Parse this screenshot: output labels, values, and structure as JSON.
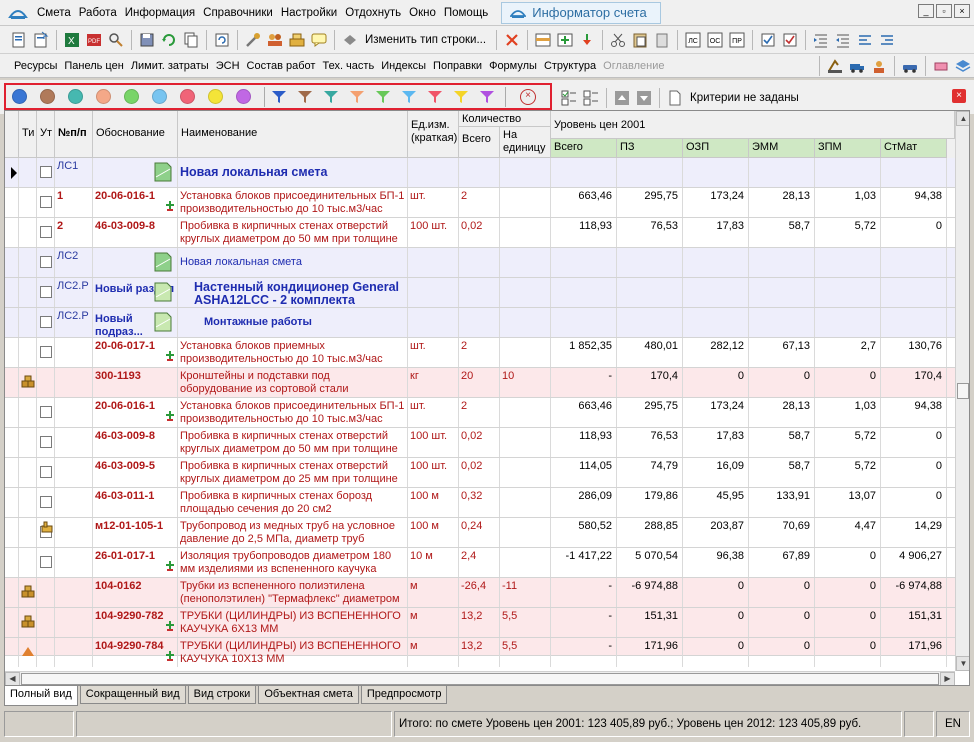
{
  "menu": {
    "items": [
      "Смета",
      "Работа",
      "Информация",
      "Справочники",
      "Настройки",
      "Отдохнуть",
      "Окно",
      "Помощь"
    ],
    "informer_tab": "Информатор счета",
    "win_buttons": [
      "_",
      "▫",
      "×"
    ]
  },
  "toolbar": {
    "change_row_type": "Изменить тип строки...",
    "icon_labels": [
      "ЛС",
      "ОС",
      "ПР"
    ]
  },
  "toolbar2": {
    "items": [
      "Ресурсы",
      "Панель цен",
      "Лимит. затраты",
      "ЭСН",
      "Состав работ",
      "Тех. часть",
      "Индексы",
      "Поправки",
      "Формулы",
      "Структура"
    ],
    "disabled_item": "Оглавление"
  },
  "filter": {
    "dot_colors": [
      "#3a76d4",
      "#b07a5a",
      "#46b8b0",
      "#f4a888",
      "#78d468",
      "#78c4f0",
      "#f06478",
      "#f4e438",
      "#c068e4"
    ],
    "funnel_colors": [
      "#2b5cc8",
      "#a06a4a",
      "#38a8a0",
      "#f4a070",
      "#68c858",
      "#5cb8f0",
      "#f05468",
      "#f4d428",
      "#b050e0"
    ],
    "criteria_text": "Критерии не заданы"
  },
  "grid": {
    "headers": {
      "ti": "Ти",
      "ut": "Ут",
      "npp": "№п/п",
      "obosn": "Обоснование",
      "naim": "Наименование",
      "edizm": "Ед.изм. (краткая)",
      "kolvo": "Количество",
      "vsego_q": "Всего",
      "na_ed": "На единицу",
      "level": "Уровень цен 2001",
      "vsego": "Всего",
      "pz": "ПЗ",
      "ozp": "ОЗП",
      "emm": "ЭММ",
      "zpm": "ЗПМ",
      "stmat": "СтМат"
    },
    "rows": [
      {
        "type": "section",
        "npp": "ЛС1",
        "title": "Новая локальная смета",
        "title_style": "bold",
        "icon": "ЛС"
      },
      {
        "type": "work",
        "npp": "1",
        "code": "20-06-016-1",
        "name": "Установка блоков присоединительных БП-1 производительностью до 10 тыс.м3/час",
        "unit": "шт.",
        "qty": "2",
        "per": "",
        "total": "663,46",
        "pz": "295,75",
        "ozp": "173,24",
        "emm": "28,13",
        "zpm": "1,03",
        "stmat": "94,38",
        "plus": true
      },
      {
        "type": "work",
        "npp": "2",
        "code": "46-03-009-8",
        "name": "Пробивка в кирпичных стенах отверстий круглых диаметром до 50 мм при толщине",
        "unit": "100 шт.",
        "qty": "0,02",
        "per": "",
        "total": "118,93",
        "pz": "76,53",
        "ozp": "17,83",
        "emm": "58,7",
        "zpm": "5,72",
        "stmat": "0",
        "plus": false
      },
      {
        "type": "section",
        "npp": "ЛС2",
        "title": "Новая локальная смета",
        "title_style": "normal",
        "icon": "ЛС"
      },
      {
        "type": "section",
        "npp": "ЛС2.Р",
        "code_label": "Новый раздел",
        "title": "Настенный кондиционер General ASHA12LCC - 2 комплекта",
        "title_style": "bold",
        "icon": "Р"
      },
      {
        "type": "section",
        "npp": "ЛС2.Р",
        "code_label": "Новый подраз...",
        "title": "Монтажные работы",
        "title_style": "sub",
        "icon": "ПР"
      },
      {
        "type": "work",
        "npp": "",
        "code": "20-06-017-1",
        "name": "Установка блоков приемных производительностью до 10 тыс.м3/час",
        "unit": "шт.",
        "qty": "2",
        "per": "",
        "total": "1 852,35",
        "pz": "480,01",
        "ozp": "282,12",
        "emm": "67,13",
        "zpm": "2,7",
        "stmat": "130,76",
        "plus": true
      },
      {
        "type": "material",
        "npp": "",
        "code": "300-1193",
        "name": "Кронштейны и подставки под оборудование из сортовой стали",
        "unit": "кг",
        "qty": "20",
        "per": "10",
        "total": "-",
        "pz": "170,4",
        "ozp": "0",
        "emm": "0",
        "zpm": "0",
        "stmat": "170,4",
        "plus": false
      },
      {
        "type": "work",
        "npp": "",
        "code": "20-06-016-1",
        "name": "Установка блоков присоединительных БП-1 производительностью до 10 тыс.м3/час",
        "unit": "шт.",
        "qty": "2",
        "per": "",
        "total": "663,46",
        "pz": "295,75",
        "ozp": "173,24",
        "emm": "28,13",
        "zpm": "1,03",
        "stmat": "94,38",
        "plus": true
      },
      {
        "type": "work",
        "npp": "",
        "code": "46-03-009-8",
        "name": "Пробивка в кирпичных стенах отверстий круглых диаметром до 50 мм при толщине",
        "unit": "100 шт.",
        "qty": "0,02",
        "per": "",
        "total": "118,93",
        "pz": "76,53",
        "ozp": "17,83",
        "emm": "58,7",
        "zpm": "5,72",
        "stmat": "0",
        "plus": false
      },
      {
        "type": "work",
        "npp": "",
        "code": "46-03-009-5",
        "name": "Пробивка в кирпичных стенах отверстий круглых диаметром до 25 мм при толщине",
        "unit": "100 шт.",
        "qty": "0,02",
        "per": "",
        "total": "114,05",
        "pz": "74,79",
        "ozp": "16,09",
        "emm": "58,7",
        "zpm": "5,72",
        "stmat": "0",
        "plus": false
      },
      {
        "type": "work",
        "npp": "",
        "code": "46-03-011-1",
        "name": "Пробивка в кирпичных стенах борозд площадью сечения до 20 см2",
        "unit": "100 м",
        "qty": "0,32",
        "per": "",
        "total": "286,09",
        "pz": "179,86",
        "ozp": "45,95",
        "emm": "133,91",
        "zpm": "13,07",
        "stmat": "0",
        "plus": false
      },
      {
        "type": "work",
        "npp": "",
        "code": "м12-01-105-1",
        "name": "Трубопровод из медных труб на условное давление до 2,5 МПа, диаметр труб",
        "unit": "100 м",
        "qty": "0,24",
        "per": "",
        "total": "580,52",
        "pz": "288,85",
        "ozp": "203,87",
        "emm": "70,69",
        "zpm": "4,47",
        "stmat": "14,29",
        "plus": false,
        "hand": true
      },
      {
        "type": "work",
        "npp": "",
        "code": "26-01-017-1",
        "name": "Изоляция трубопроводов диаметром 180 мм изделиями из вспененного каучука",
        "unit": "10 м",
        "qty": "2,4",
        "per": "",
        "total": "-1 417,22",
        "pz": "5 070,54",
        "ozp": "96,38",
        "emm": "67,89",
        "zpm": "0",
        "stmat": "4 906,27",
        "plus": true
      },
      {
        "type": "material",
        "npp": "",
        "code": "104-0162",
        "name": "Трубки из вспененного полиэтилена (пенополэтилен) \"Термафлекс\" диаметром",
        "unit": "м",
        "qty": "-26,4",
        "per": "-11",
        "total": "-",
        "pz": "-6 974,88",
        "ozp": "0",
        "emm": "0",
        "zpm": "0",
        "stmat": "-6 974,88",
        "plus": false
      },
      {
        "type": "material",
        "npp": "",
        "code": "104-9290-782",
        "name": "ТРУБКИ (ЦИЛИНДРЫ) ИЗ ВСПЕНЕННОГО КАУЧУКА 6Х13 ММ",
        "unit": "м",
        "qty": "13,2",
        "per": "5,5",
        "total": "-",
        "pz": "151,31",
        "ozp": "0",
        "emm": "0",
        "zpm": "0",
        "stmat": "151,31",
        "plus": true
      },
      {
        "type": "material",
        "npp": "",
        "code": "104-9290-784",
        "name": "ТРУБКИ (ЦИЛИНДРЫ) ИЗ ВСПЕНЕННОГО КАУЧУКА 10Х13 ММ",
        "unit": "м",
        "qty": "13,2",
        "per": "5,5",
        "total": "-",
        "pz": "171,96",
        "ozp": "0",
        "emm": "0",
        "zpm": "0",
        "stmat": "171,96",
        "plus": true,
        "last": true
      }
    ]
  },
  "tabs": [
    "Полный вид",
    "Сокращенный вид",
    "Вид строки",
    "Объектная смета",
    "Предпросмотр"
  ],
  "status": {
    "summary": "Итого: по смете Уровень цен 2001: 123 405,89 руб.;  Уровень цен 2012: 123 405,89 руб.",
    "lang": "EN"
  }
}
